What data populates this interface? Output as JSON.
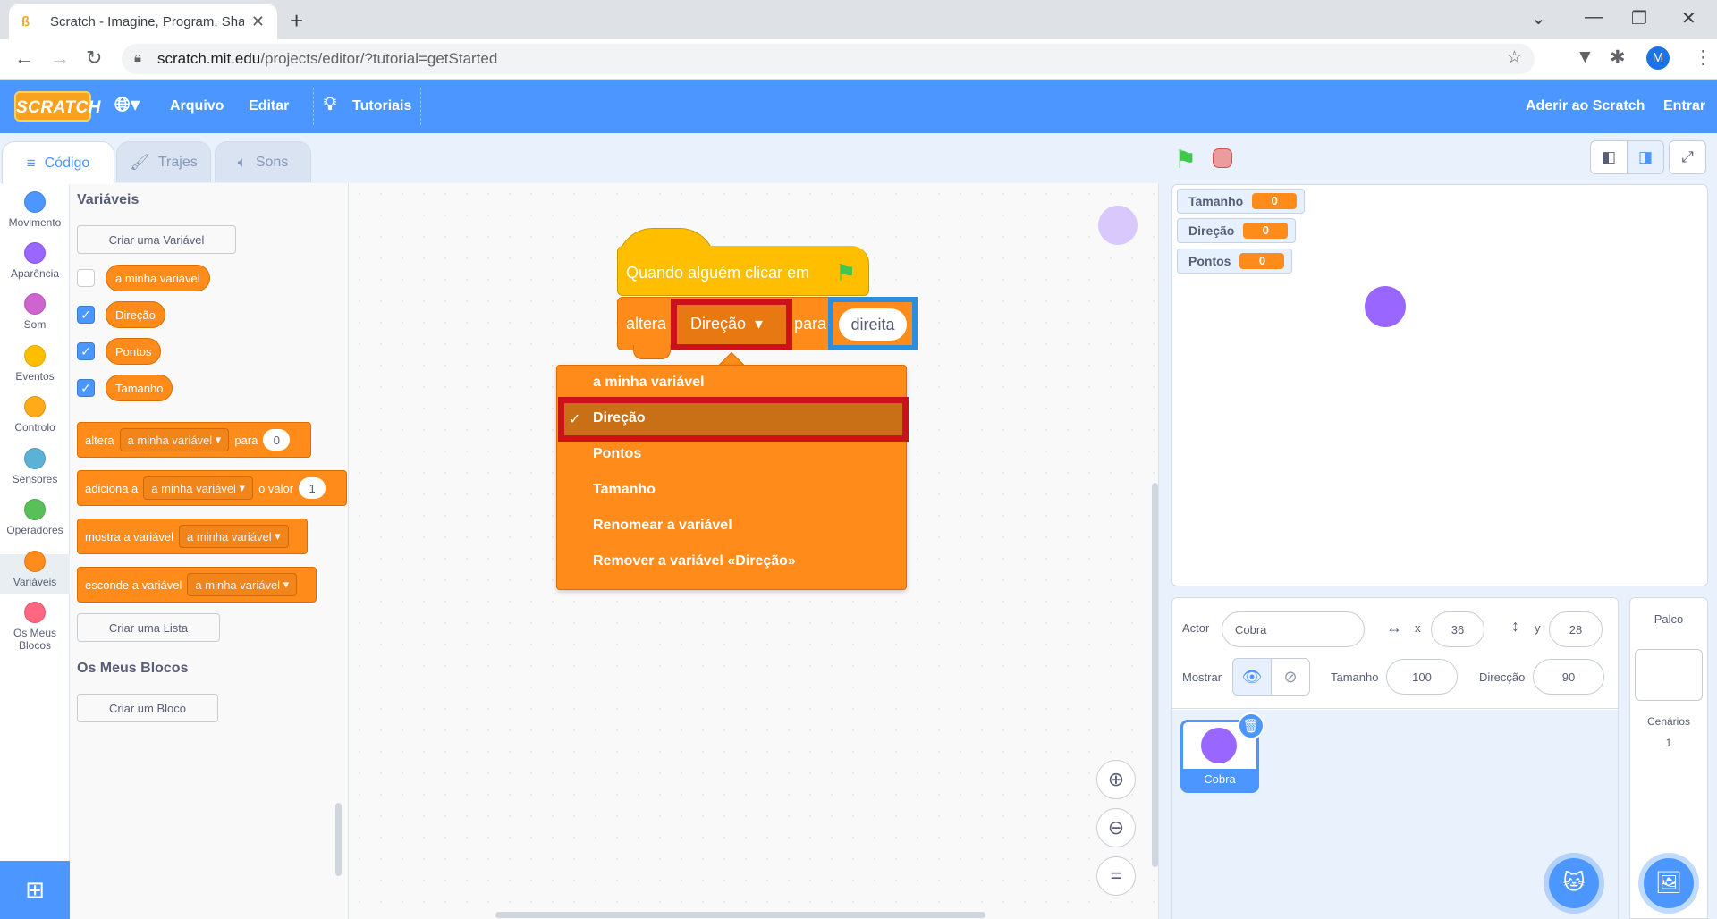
{
  "browser": {
    "tab_title": "Scratch - Imagine, Program, Share",
    "url_host": "scratch.mit.edu",
    "url_path": "/projects/editor/?tutorial=getStarted",
    "profile_initial": "M"
  },
  "menubar": {
    "logo": "SCRATCH",
    "file": "Arquivo",
    "edit": "Editar",
    "tutorials": "Tutoriais",
    "join": "Aderir ao Scratch",
    "signin": "Entrar"
  },
  "editor_tabs": {
    "code": "Código",
    "costumes": "Trajes",
    "sounds": "Sons"
  },
  "categories": [
    {
      "label": "Movimento",
      "color": "#4c97ff"
    },
    {
      "label": "Aparência",
      "color": "#9966ff"
    },
    {
      "label": "Som",
      "color": "#cf63cf"
    },
    {
      "label": "Eventos",
      "color": "#ffbf00"
    },
    {
      "label": "Controlo",
      "color": "#ffab19"
    },
    {
      "label": "Sensores",
      "color": "#5cb1d6"
    },
    {
      "label": "Operadores",
      "color": "#59c059"
    },
    {
      "label": "Variáveis",
      "color": "#ff8c1a"
    },
    {
      "label_1": "Os Meus",
      "label_2": "Blocos",
      "color": "#ff6680"
    }
  ],
  "palette": {
    "heading": "Variáveis",
    "make_variable": "Criar uma Variável",
    "variables": [
      "a minha variável",
      "Direção",
      "Pontos",
      "Tamanho"
    ],
    "blocks": {
      "set": {
        "a": "altera",
        "var": "a minha variável",
        "b": "para",
        "val": "0"
      },
      "change": {
        "a": "adiciona a",
        "var": "a minha variável",
        "b": "o valor",
        "val": "1"
      },
      "show": {
        "a": "mostra a variável",
        "var": "a minha variável"
      },
      "hide": {
        "a": "esconde a variável",
        "var": "a minha variável"
      }
    },
    "make_list": "Criar uma Lista",
    "my_blocks_heading": "Os Meus Blocos",
    "make_block": "Criar um Bloco"
  },
  "workspace": {
    "hat_label": "Quando alguém clicar em",
    "set_label": "altera",
    "set_var": "Direção",
    "set_to": "para",
    "set_value": "direita",
    "dropdown": [
      "a minha variável",
      "Direção",
      "Pontos",
      "Tamanho",
      "Renomear a variável",
      "Remover a variável «Direção»"
    ]
  },
  "monitors": [
    {
      "name": "Tamanho",
      "value": "0"
    },
    {
      "name": "Direção",
      "value": "0"
    },
    {
      "name": "Pontos",
      "value": "0"
    }
  ],
  "sprite_info": {
    "actor_label": "Actor",
    "actor_name": "Cobra",
    "x_label": "x",
    "x": "36",
    "y_label": "y",
    "y": "28",
    "show_label": "Mostrar",
    "size_label": "Tamanho",
    "size": "100",
    "direction_label": "Direcção",
    "direction": "90"
  },
  "sprite_tile": {
    "name": "Cobra"
  },
  "stage_pane": {
    "title": "Palco",
    "backdrops_label": "Cenários",
    "backdrops_count": "1"
  }
}
